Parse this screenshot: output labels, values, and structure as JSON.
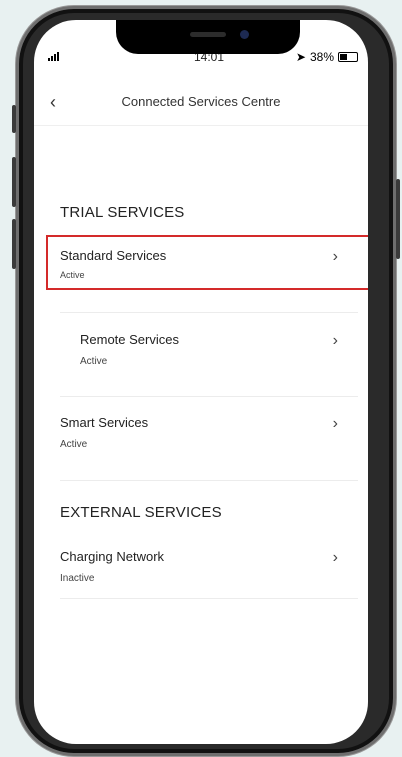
{
  "status_bar": {
    "time": "14:01",
    "battery": "38%",
    "battery_level": 0.38
  },
  "header": {
    "back_icon": "chevron-left-icon",
    "title": "Connected Services Centre"
  },
  "trial_section": {
    "title": "TRIAL SERVICES",
    "items": [
      {
        "label": "Standard Services",
        "status": "Active"
      },
      {
        "label": "Remote Services",
        "status": "Active"
      },
      {
        "label": "Smart Services",
        "status": "Active"
      }
    ]
  },
  "external_section": {
    "title": "EXTERNAL SERVICES",
    "items": [
      {
        "label": "Charging Network",
        "status": "Inactive"
      }
    ]
  },
  "colors": {
    "highlight": "#d42a2a",
    "background": "#e8f1f1"
  }
}
